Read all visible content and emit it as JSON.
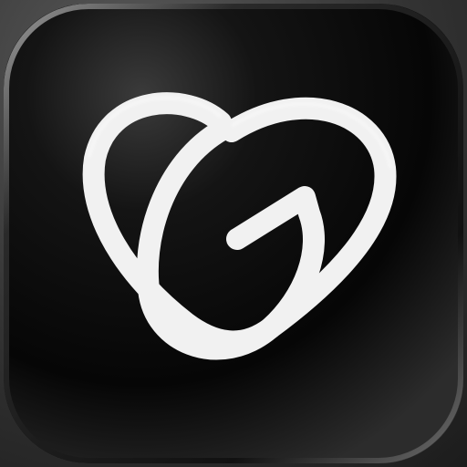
{
  "app_icon": {
    "logo": "heart-g-logo-icon",
    "tile_color": "#050505",
    "logo_color": "#f2f2f2",
    "frame_color": "#3a3a3a"
  }
}
